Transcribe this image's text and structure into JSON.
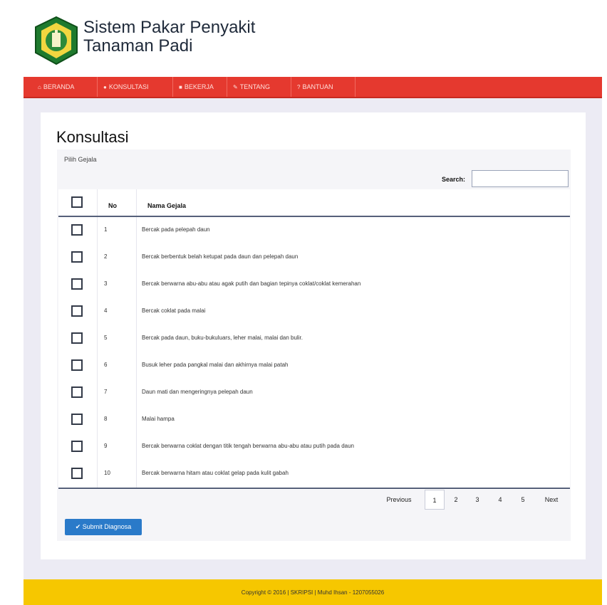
{
  "header": {
    "title_line1": "Sistem Pakar Penyakit",
    "title_line2": "Tanaman Padi"
  },
  "nav": {
    "items": [
      {
        "label": "BERANDA",
        "icon": "home-icon"
      },
      {
        "label": "KONSULTASI",
        "icon": "user-icon"
      },
      {
        "label": "BEKERJA",
        "icon": "book-icon"
      },
      {
        "label": "TENTANG",
        "icon": "pencil-icon"
      },
      {
        "label": "BANTUAN",
        "icon": "help-icon"
      }
    ],
    "color": "#e5392f"
  },
  "main": {
    "heading": "Konsultasi",
    "box_label": "Pilih Gejala",
    "search_label": "Search:",
    "search_value": "",
    "columns": [
      "No",
      "Nama Gejala"
    ],
    "rows": [
      {
        "no": "1",
        "name": "Bercak pada pelepah daun"
      },
      {
        "no": "2",
        "name": "Bercak berbentuk belah ketupat pada daun dan pelepah daun"
      },
      {
        "no": "3",
        "name": "Bercak berwarna abu-abu atau agak putih dan bagian tepinya coklat/coklat kemerahan"
      },
      {
        "no": "4",
        "name": "Bercak coklat pada malai"
      },
      {
        "no": "5",
        "name": "Bercak pada daun, buku-bukuluars, leher malai, malai dan bulir."
      },
      {
        "no": "6",
        "name": "Busuk leher pada pangkal malai dan akhirnya malai patah"
      },
      {
        "no": "7",
        "name": "Daun mati dan mengeringnya pelepah daun"
      },
      {
        "no": "8",
        "name": "Malai hampa"
      },
      {
        "no": "9",
        "name": "Bercak berwarna coklat dengan titik tengah berwarna abu-abu atau putih pada daun"
      },
      {
        "no": "10",
        "name": "Bercak berwarna hitam atau coklat gelap pada kulit gabah"
      }
    ],
    "pagination": {
      "previous": "Previous",
      "pages": [
        "1",
        "2",
        "3",
        "4",
        "5"
      ],
      "active": "1",
      "next": "Next"
    },
    "submit_label": "Submit Diagnosa",
    "submit_color": "#2a7ac9"
  },
  "footer": {
    "text": "Copyright © 2016 | SKRIPSI | Muhd Ihsan - 1207055026",
    "color": "#f6c700"
  }
}
